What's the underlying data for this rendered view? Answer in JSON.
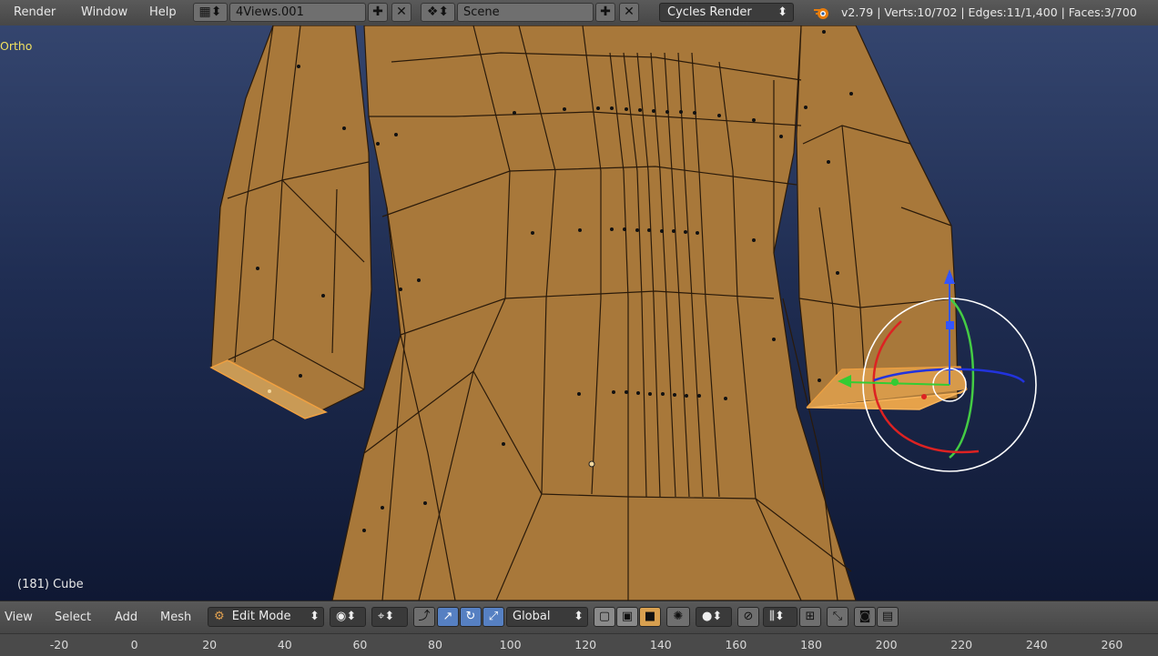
{
  "menu": [
    "Render",
    "Window",
    "Help"
  ],
  "screen_layout": {
    "value": "4Views.001"
  },
  "scene": {
    "value": "Scene"
  },
  "render_engine": {
    "value": "Cycles Render"
  },
  "stats": "v2.79 | Verts:10/702 | Edges:11/1,400 | Faces:3/700",
  "viewport": {
    "view_label": "Ortho",
    "object_label": "(181) Cube"
  },
  "bottom_menu": [
    "View",
    "Select",
    "Add",
    "Mesh"
  ],
  "mode": {
    "value": "Edit Mode"
  },
  "orientation": {
    "value": "Global"
  },
  "ruler_ticks": [
    "-20",
    "0",
    "20",
    "40",
    "60",
    "80",
    "100",
    "120",
    "140",
    "160",
    "180",
    "200",
    "220",
    "240",
    "260"
  ],
  "colors": {
    "mesh_face": "#a8783a",
    "edge": "#2a1a0a",
    "selected": "#f0a040",
    "background_top": "#34456e",
    "background_bottom": "#0f1833"
  },
  "icons": [
    "screen-layout-icon",
    "scene-icon",
    "blender-logo-icon",
    "mode-icon",
    "shading-icon",
    "pivot-icon",
    "manipulator-icon",
    "translate-icon",
    "rotate-icon",
    "scale-icon",
    "vertex-select-icon",
    "edge-select-icon",
    "face-select-icon",
    "occlude-icon",
    "proportional-icon",
    "snap-icon",
    "snap-target-icon",
    "render-icon",
    "anim-render-icon"
  ]
}
